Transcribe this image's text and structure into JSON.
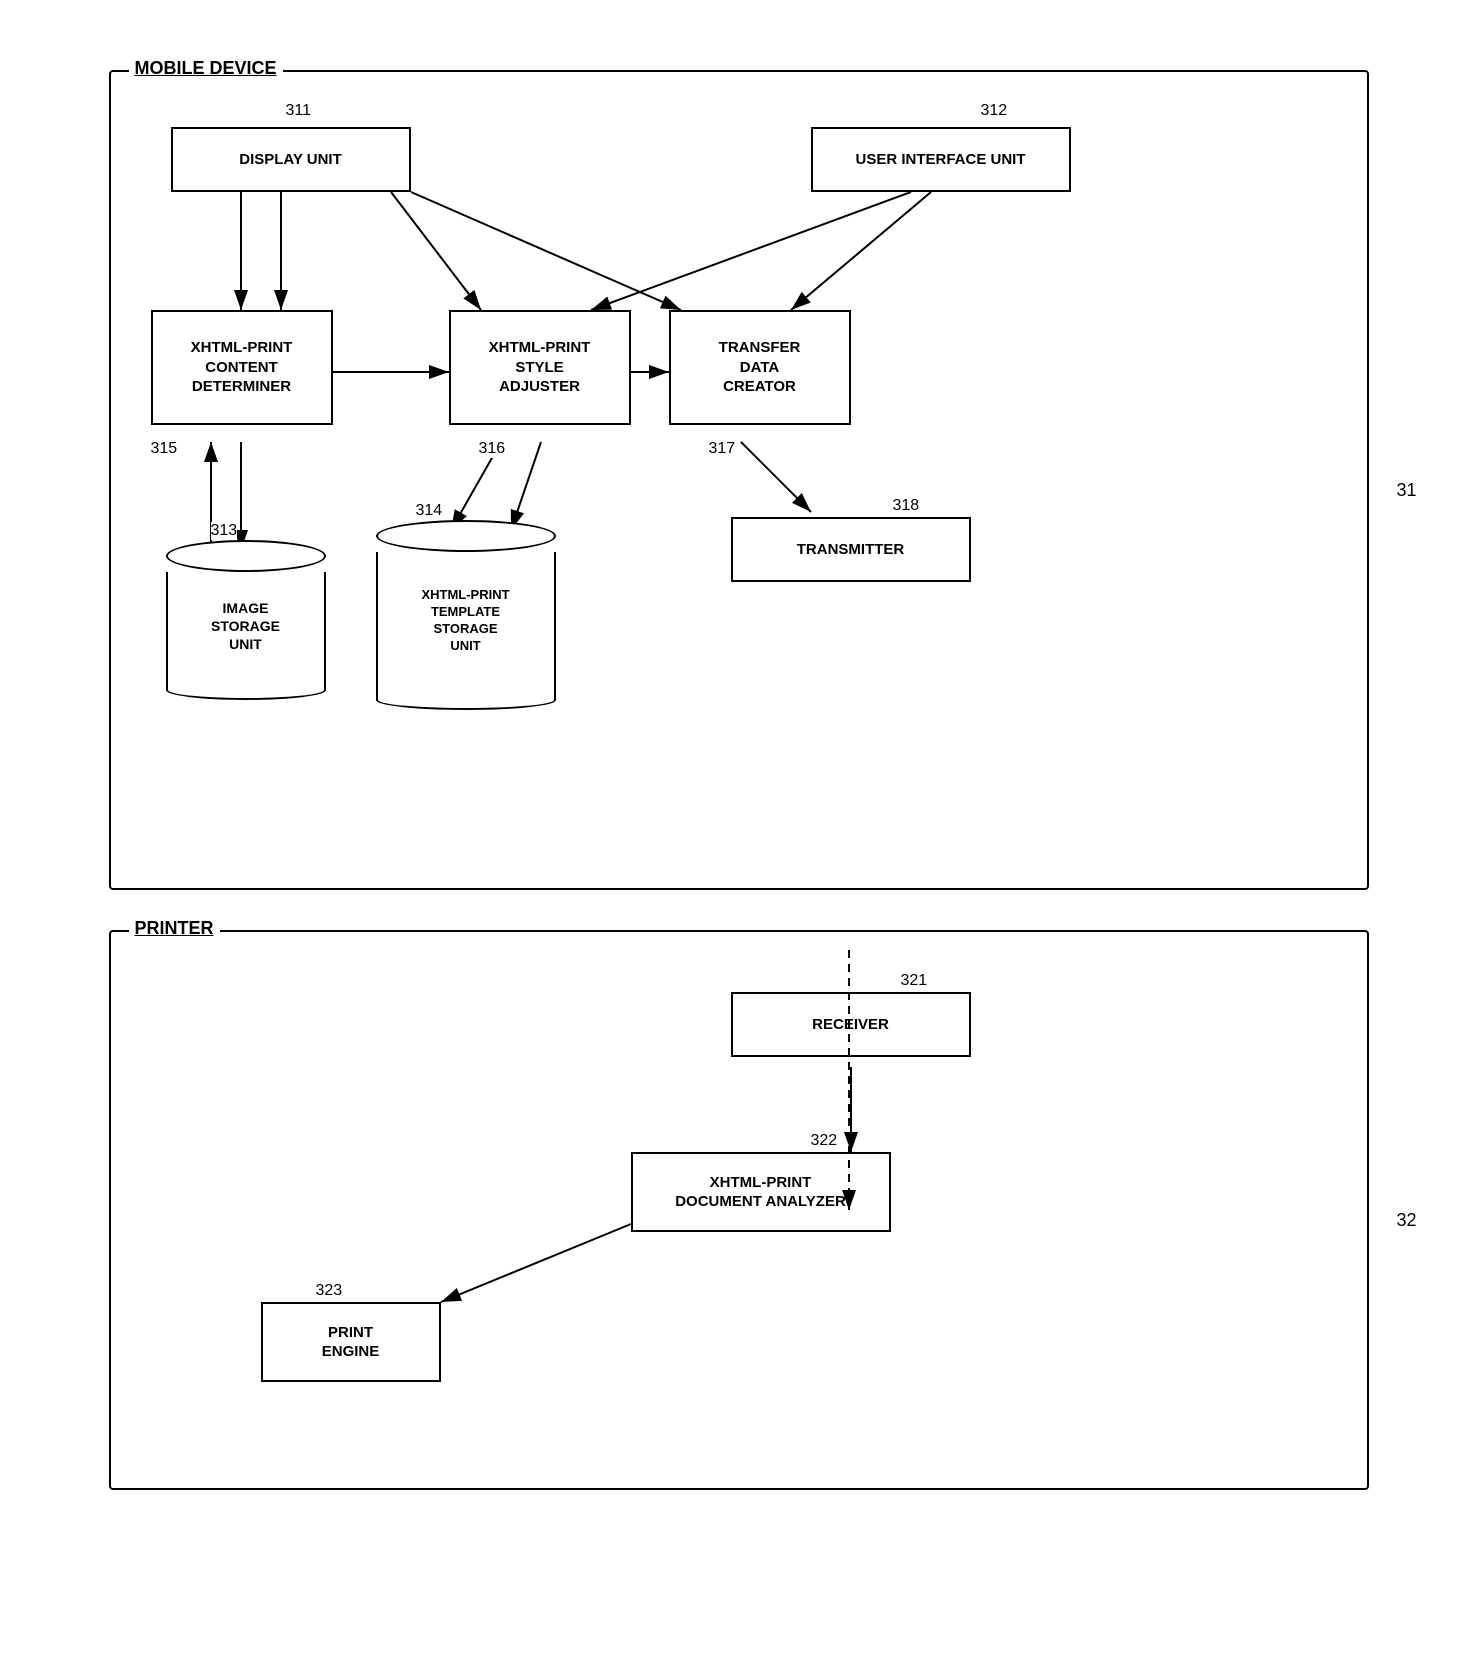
{
  "diagram": {
    "mobile_section": {
      "label": "MOBILE DEVICE",
      "ref": "31"
    },
    "printer_section": {
      "label": "PRINTER",
      "ref": "32"
    },
    "boxes": {
      "display_unit": {
        "label": "DISPLAY UNIT",
        "ref": "311"
      },
      "user_interface_unit": {
        "label": "USER INTERFACE UNIT",
        "ref": "312"
      },
      "xhtml_content": {
        "label": "XHTML-PRINT\nCONTENT\nDETERMINER",
        "ref": "315"
      },
      "xhtml_style": {
        "label": "XHTML-PRINT\nSTYLE\nADJUSTER",
        "ref": "316"
      },
      "transfer_data": {
        "label": "TRANSFER\nDATA\nCREATOR",
        "ref": "317"
      },
      "transmitter": {
        "label": "TRANSMITTER",
        "ref": "318"
      },
      "receiver": {
        "label": "RECEIVER",
        "ref": "321"
      },
      "xhtml_document": {
        "label": "XHTML-PRINT\nDOCUMENT ANALYZER",
        "ref": "322"
      },
      "print_engine": {
        "label": "PRINT\nENGINE",
        "ref": "323"
      }
    },
    "cylinders": {
      "image_storage": {
        "label": "IMAGE\nSTORAGE\nUNIT",
        "ref": "313"
      },
      "xhtml_template": {
        "label": "XHTML-PRINT\nTEMPLATE\nSTORAGE\nUNIT",
        "ref": "314"
      }
    }
  }
}
